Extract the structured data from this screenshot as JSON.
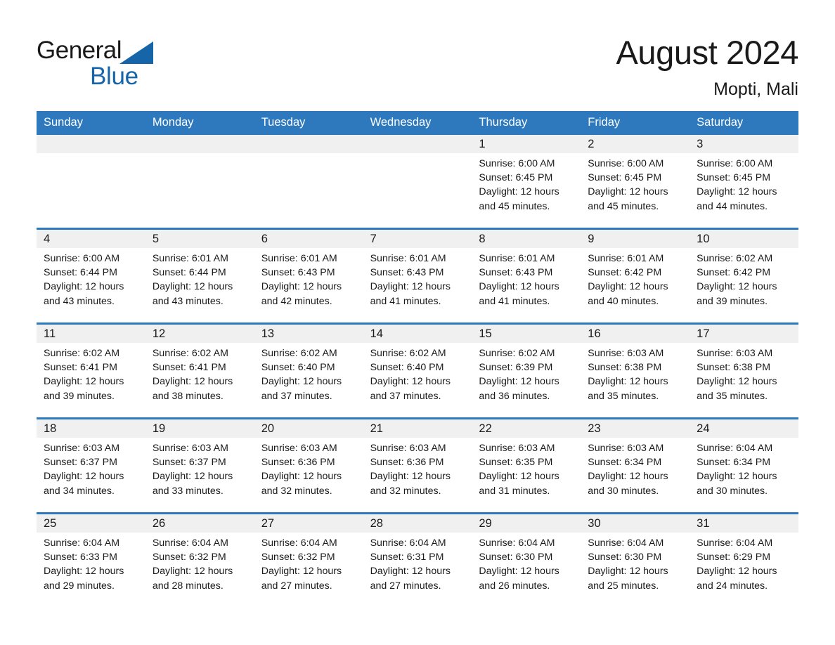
{
  "brand": {
    "name_part1": "General",
    "name_part2": "Blue",
    "triangle_icon": "triangle-icon",
    "accent_color": "#1565a8"
  },
  "header": {
    "title": "August 2024",
    "location": "Mopti, Mali"
  },
  "calendar": {
    "header_bg": "#2e79bd",
    "daynum_bg": "#f0f0f0",
    "weekdays": [
      "Sunday",
      "Monday",
      "Tuesday",
      "Wednesday",
      "Thursday",
      "Friday",
      "Saturday"
    ],
    "weeks": [
      [
        {
          "day": "",
          "empty": true,
          "sunrise": "",
          "sunset": "",
          "daylight_line1": "",
          "daylight_line2": ""
        },
        {
          "day": "",
          "empty": true,
          "sunrise": "",
          "sunset": "",
          "daylight_line1": "",
          "daylight_line2": ""
        },
        {
          "day": "",
          "empty": true,
          "sunrise": "",
          "sunset": "",
          "daylight_line1": "",
          "daylight_line2": ""
        },
        {
          "day": "",
          "empty": true,
          "sunrise": "",
          "sunset": "",
          "daylight_line1": "",
          "daylight_line2": ""
        },
        {
          "day": "1",
          "empty": false,
          "sunrise": "Sunrise: 6:00 AM",
          "sunset": "Sunset: 6:45 PM",
          "daylight_line1": "Daylight: 12 hours",
          "daylight_line2": "and 45 minutes."
        },
        {
          "day": "2",
          "empty": false,
          "sunrise": "Sunrise: 6:00 AM",
          "sunset": "Sunset: 6:45 PM",
          "daylight_line1": "Daylight: 12 hours",
          "daylight_line2": "and 45 minutes."
        },
        {
          "day": "3",
          "empty": false,
          "sunrise": "Sunrise: 6:00 AM",
          "sunset": "Sunset: 6:45 PM",
          "daylight_line1": "Daylight: 12 hours",
          "daylight_line2": "and 44 minutes."
        }
      ],
      [
        {
          "day": "4",
          "empty": false,
          "sunrise": "Sunrise: 6:00 AM",
          "sunset": "Sunset: 6:44 PM",
          "daylight_line1": "Daylight: 12 hours",
          "daylight_line2": "and 43 minutes."
        },
        {
          "day": "5",
          "empty": false,
          "sunrise": "Sunrise: 6:01 AM",
          "sunset": "Sunset: 6:44 PM",
          "daylight_line1": "Daylight: 12 hours",
          "daylight_line2": "and 43 minutes."
        },
        {
          "day": "6",
          "empty": false,
          "sunrise": "Sunrise: 6:01 AM",
          "sunset": "Sunset: 6:43 PM",
          "daylight_line1": "Daylight: 12 hours",
          "daylight_line2": "and 42 minutes."
        },
        {
          "day": "7",
          "empty": false,
          "sunrise": "Sunrise: 6:01 AM",
          "sunset": "Sunset: 6:43 PM",
          "daylight_line1": "Daylight: 12 hours",
          "daylight_line2": "and 41 minutes."
        },
        {
          "day": "8",
          "empty": false,
          "sunrise": "Sunrise: 6:01 AM",
          "sunset": "Sunset: 6:43 PM",
          "daylight_line1": "Daylight: 12 hours",
          "daylight_line2": "and 41 minutes."
        },
        {
          "day": "9",
          "empty": false,
          "sunrise": "Sunrise: 6:01 AM",
          "sunset": "Sunset: 6:42 PM",
          "daylight_line1": "Daylight: 12 hours",
          "daylight_line2": "and 40 minutes."
        },
        {
          "day": "10",
          "empty": false,
          "sunrise": "Sunrise: 6:02 AM",
          "sunset": "Sunset: 6:42 PM",
          "daylight_line1": "Daylight: 12 hours",
          "daylight_line2": "and 39 minutes."
        }
      ],
      [
        {
          "day": "11",
          "empty": false,
          "sunrise": "Sunrise: 6:02 AM",
          "sunset": "Sunset: 6:41 PM",
          "daylight_line1": "Daylight: 12 hours",
          "daylight_line2": "and 39 minutes."
        },
        {
          "day": "12",
          "empty": false,
          "sunrise": "Sunrise: 6:02 AM",
          "sunset": "Sunset: 6:41 PM",
          "daylight_line1": "Daylight: 12 hours",
          "daylight_line2": "and 38 minutes."
        },
        {
          "day": "13",
          "empty": false,
          "sunrise": "Sunrise: 6:02 AM",
          "sunset": "Sunset: 6:40 PM",
          "daylight_line1": "Daylight: 12 hours",
          "daylight_line2": "and 37 minutes."
        },
        {
          "day": "14",
          "empty": false,
          "sunrise": "Sunrise: 6:02 AM",
          "sunset": "Sunset: 6:40 PM",
          "daylight_line1": "Daylight: 12 hours",
          "daylight_line2": "and 37 minutes."
        },
        {
          "day": "15",
          "empty": false,
          "sunrise": "Sunrise: 6:02 AM",
          "sunset": "Sunset: 6:39 PM",
          "daylight_line1": "Daylight: 12 hours",
          "daylight_line2": "and 36 minutes."
        },
        {
          "day": "16",
          "empty": false,
          "sunrise": "Sunrise: 6:03 AM",
          "sunset": "Sunset: 6:38 PM",
          "daylight_line1": "Daylight: 12 hours",
          "daylight_line2": "and 35 minutes."
        },
        {
          "day": "17",
          "empty": false,
          "sunrise": "Sunrise: 6:03 AM",
          "sunset": "Sunset: 6:38 PM",
          "daylight_line1": "Daylight: 12 hours",
          "daylight_line2": "and 35 minutes."
        }
      ],
      [
        {
          "day": "18",
          "empty": false,
          "sunrise": "Sunrise: 6:03 AM",
          "sunset": "Sunset: 6:37 PM",
          "daylight_line1": "Daylight: 12 hours",
          "daylight_line2": "and 34 minutes."
        },
        {
          "day": "19",
          "empty": false,
          "sunrise": "Sunrise: 6:03 AM",
          "sunset": "Sunset: 6:37 PM",
          "daylight_line1": "Daylight: 12 hours",
          "daylight_line2": "and 33 minutes."
        },
        {
          "day": "20",
          "empty": false,
          "sunrise": "Sunrise: 6:03 AM",
          "sunset": "Sunset: 6:36 PM",
          "daylight_line1": "Daylight: 12 hours",
          "daylight_line2": "and 32 minutes."
        },
        {
          "day": "21",
          "empty": false,
          "sunrise": "Sunrise: 6:03 AM",
          "sunset": "Sunset: 6:36 PM",
          "daylight_line1": "Daylight: 12 hours",
          "daylight_line2": "and 32 minutes."
        },
        {
          "day": "22",
          "empty": false,
          "sunrise": "Sunrise: 6:03 AM",
          "sunset": "Sunset: 6:35 PM",
          "daylight_line1": "Daylight: 12 hours",
          "daylight_line2": "and 31 minutes."
        },
        {
          "day": "23",
          "empty": false,
          "sunrise": "Sunrise: 6:03 AM",
          "sunset": "Sunset: 6:34 PM",
          "daylight_line1": "Daylight: 12 hours",
          "daylight_line2": "and 30 minutes."
        },
        {
          "day": "24",
          "empty": false,
          "sunrise": "Sunrise: 6:04 AM",
          "sunset": "Sunset: 6:34 PM",
          "daylight_line1": "Daylight: 12 hours",
          "daylight_line2": "and 30 minutes."
        }
      ],
      [
        {
          "day": "25",
          "empty": false,
          "sunrise": "Sunrise: 6:04 AM",
          "sunset": "Sunset: 6:33 PM",
          "daylight_line1": "Daylight: 12 hours",
          "daylight_line2": "and 29 minutes."
        },
        {
          "day": "26",
          "empty": false,
          "sunrise": "Sunrise: 6:04 AM",
          "sunset": "Sunset: 6:32 PM",
          "daylight_line1": "Daylight: 12 hours",
          "daylight_line2": "and 28 minutes."
        },
        {
          "day": "27",
          "empty": false,
          "sunrise": "Sunrise: 6:04 AM",
          "sunset": "Sunset: 6:32 PM",
          "daylight_line1": "Daylight: 12 hours",
          "daylight_line2": "and 27 minutes."
        },
        {
          "day": "28",
          "empty": false,
          "sunrise": "Sunrise: 6:04 AM",
          "sunset": "Sunset: 6:31 PM",
          "daylight_line1": "Daylight: 12 hours",
          "daylight_line2": "and 27 minutes."
        },
        {
          "day": "29",
          "empty": false,
          "sunrise": "Sunrise: 6:04 AM",
          "sunset": "Sunset: 6:30 PM",
          "daylight_line1": "Daylight: 12 hours",
          "daylight_line2": "and 26 minutes."
        },
        {
          "day": "30",
          "empty": false,
          "sunrise": "Sunrise: 6:04 AM",
          "sunset": "Sunset: 6:30 PM",
          "daylight_line1": "Daylight: 12 hours",
          "daylight_line2": "and 25 minutes."
        },
        {
          "day": "31",
          "empty": false,
          "sunrise": "Sunrise: 6:04 AM",
          "sunset": "Sunset: 6:29 PM",
          "daylight_line1": "Daylight: 12 hours",
          "daylight_line2": "and 24 minutes."
        }
      ]
    ]
  }
}
